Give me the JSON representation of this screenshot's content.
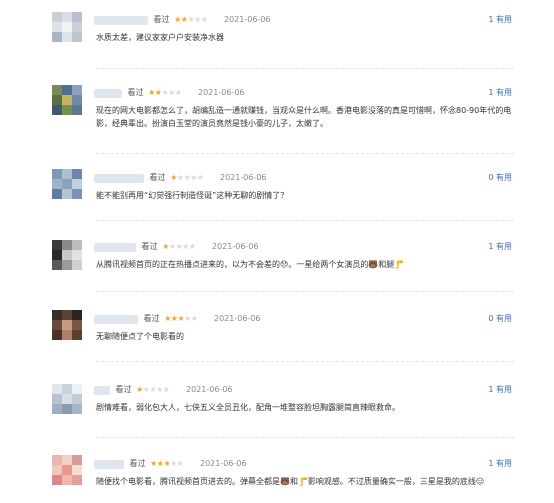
{
  "reviews": [
    {
      "seen": "看过",
      "filled": 2,
      "date": "2021-06-06",
      "helpful": "1 有用",
      "text": "水质太差，建议家家户户安装净水器"
    },
    {
      "seen": "看过",
      "filled": 2,
      "date": "2021-06-06",
      "helpful": "1 有用",
      "text": "现在的网大电影都怎么了，胡编乱造一通就赚钱，当观众是什么啊。香港电影没落的真是可惜啊，怀念80-90年代的电影，经典辈出。扮演白玉堂的演员竟然是钱小豪的儿子，太嫩了。"
    },
    {
      "seen": "看过",
      "filled": 1,
      "date": "2021-06-06",
      "helpful": "0 有用",
      "text": "能不能别再用“幻觉强行制造怪诞”这种无聊的剧情了？"
    },
    {
      "seen": "看过",
      "filled": 1,
      "date": "2021-06-06",
      "helpful": "1 有用",
      "text": "从腾讯视频首页的正在热播点进来的，以为不会差的😞。一星给两个女演员的🐻和腿🦵"
    },
    {
      "seen": "看过",
      "filled": 3,
      "date": "2021-06-06",
      "helpful": "0 有用",
      "text": "无聊随便点了个电影看的"
    },
    {
      "seen": "看过",
      "filled": 1,
      "date": "2021-06-06",
      "helpful": "1 有用",
      "text": "剧情难看，弱化包大人，七侠五义全员丑化，配角一堆整容脸坦胸露腿简直辣眼救命。"
    },
    {
      "seen": "看过",
      "filled": 3,
      "date": "2021-06-06",
      "helpful": "1 有用",
      "text": "随便找个电影看，腾讯视频首页进去的。弹幕全都是🐻和🦵影响观感。不过质量确实一般，三星是我的底线😑"
    }
  ]
}
